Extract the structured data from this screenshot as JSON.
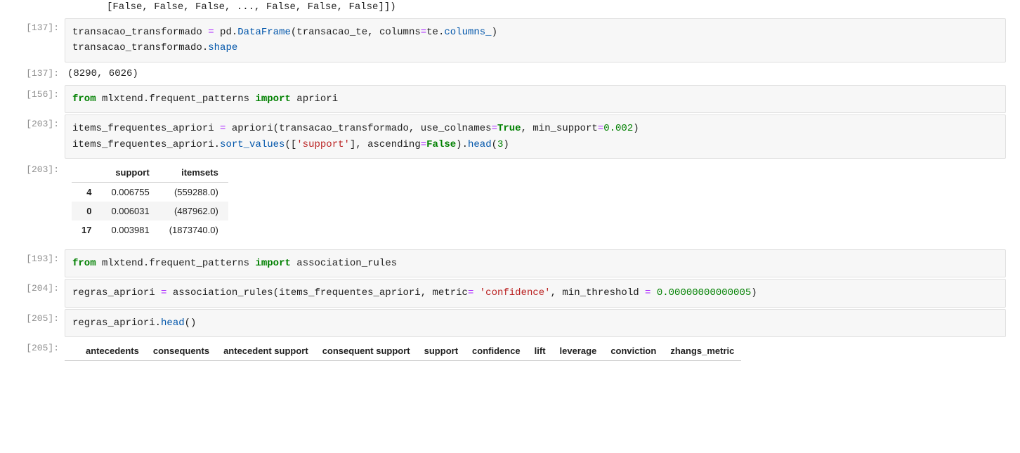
{
  "top_output": "[False, False, False, ..., False, False, False]])",
  "cells": {
    "c137a": {
      "prompt": "[137]:",
      "code": [
        {
          "type": "line",
          "tokens": [
            {
              "t": "name",
              "v": "transacao_transformado "
            },
            {
              "t": "op",
              "v": "="
            },
            {
              "t": "name",
              "v": " pd"
            },
            {
              "t": "punct",
              "v": "."
            },
            {
              "t": "call",
              "v": "DataFrame"
            },
            {
              "t": "punct",
              "v": "("
            },
            {
              "t": "name",
              "v": "transacao_te"
            },
            {
              "t": "punct",
              "v": ", "
            },
            {
              "t": "name",
              "v": "columns"
            },
            {
              "t": "op",
              "v": "="
            },
            {
              "t": "name",
              "v": "te"
            },
            {
              "t": "punct",
              "v": "."
            },
            {
              "t": "call",
              "v": "columns_"
            },
            {
              "t": "punct",
              "v": ")"
            }
          ]
        },
        {
          "type": "line",
          "tokens": [
            {
              "t": "name",
              "v": "transacao_transformado"
            },
            {
              "t": "punct",
              "v": "."
            },
            {
              "t": "call",
              "v": "shape"
            }
          ]
        }
      ]
    },
    "c137b": {
      "prompt": "[137]:",
      "plain": "(8290, 6026)"
    },
    "c156": {
      "prompt": "[156]:",
      "code": [
        {
          "type": "line",
          "tokens": [
            {
              "t": "kw",
              "v": "from"
            },
            {
              "t": "name",
              "v": " mlxtend"
            },
            {
              "t": "punct",
              "v": "."
            },
            {
              "t": "name",
              "v": "frequent_patterns "
            },
            {
              "t": "kw",
              "v": "import"
            },
            {
              "t": "name",
              "v": " apriori"
            }
          ]
        }
      ]
    },
    "c203a": {
      "prompt": "[203]:",
      "code": [
        {
          "type": "line",
          "tokens": [
            {
              "t": "name",
              "v": "items_frequentes_apriori "
            },
            {
              "t": "op",
              "v": "="
            },
            {
              "t": "name",
              "v": " apriori"
            },
            {
              "t": "punct",
              "v": "("
            },
            {
              "t": "name",
              "v": "transacao_transformado"
            },
            {
              "t": "punct",
              "v": ", "
            },
            {
              "t": "name",
              "v": "use_colnames"
            },
            {
              "t": "op",
              "v": "="
            },
            {
              "t": "bool",
              "v": "True"
            },
            {
              "t": "punct",
              "v": ", "
            },
            {
              "t": "name",
              "v": "min_support"
            },
            {
              "t": "op",
              "v": "="
            },
            {
              "t": "num",
              "v": "0.002"
            },
            {
              "t": "punct",
              "v": ")"
            }
          ]
        },
        {
          "type": "line",
          "tokens": [
            {
              "t": "name",
              "v": "items_frequentes_apriori"
            },
            {
              "t": "punct",
              "v": "."
            },
            {
              "t": "call",
              "v": "sort_values"
            },
            {
              "t": "punct",
              "v": "(["
            },
            {
              "t": "str",
              "v": "'support'"
            },
            {
              "t": "punct",
              "v": "], "
            },
            {
              "t": "name",
              "v": "ascending"
            },
            {
              "t": "op",
              "v": "="
            },
            {
              "t": "bool",
              "v": "False"
            },
            {
              "t": "punct",
              "v": ")"
            },
            {
              "t": "punct",
              "v": "."
            },
            {
              "t": "call",
              "v": "head"
            },
            {
              "t": "punct",
              "v": "("
            },
            {
              "t": "num",
              "v": "3"
            },
            {
              "t": "punct",
              "v": ")"
            }
          ]
        }
      ]
    },
    "c203b": {
      "prompt": "[203]:",
      "df": {
        "columns": [
          "support",
          "itemsets"
        ],
        "rows": [
          {
            "idx": "4",
            "support": "0.006755",
            "itemsets": "(559288.0)"
          },
          {
            "idx": "0",
            "support": "0.006031",
            "itemsets": "(487962.0)"
          },
          {
            "idx": "17",
            "support": "0.003981",
            "itemsets": "(1873740.0)"
          }
        ]
      }
    },
    "c193": {
      "prompt": "[193]:",
      "code": [
        {
          "type": "line",
          "tokens": [
            {
              "t": "kw",
              "v": "from"
            },
            {
              "t": "name",
              "v": " mlxtend"
            },
            {
              "t": "punct",
              "v": "."
            },
            {
              "t": "name",
              "v": "frequent_patterns "
            },
            {
              "t": "kw",
              "v": "import"
            },
            {
              "t": "name",
              "v": " association_rules"
            }
          ]
        }
      ]
    },
    "c204": {
      "prompt": "[204]:",
      "code": [
        {
          "type": "line",
          "tokens": [
            {
              "t": "name",
              "v": "regras_apriori "
            },
            {
              "t": "op",
              "v": "="
            },
            {
              "t": "name",
              "v": " association_rules"
            },
            {
              "t": "punct",
              "v": "("
            },
            {
              "t": "name",
              "v": "items_frequentes_apriori"
            },
            {
              "t": "punct",
              "v": ", "
            },
            {
              "t": "name",
              "v": "metric"
            },
            {
              "t": "op",
              "v": "="
            },
            {
              "t": "name",
              "v": " "
            },
            {
              "t": "str",
              "v": "'confidence'"
            },
            {
              "t": "punct",
              "v": ", "
            },
            {
              "t": "name",
              "v": "min_threshold "
            },
            {
              "t": "op",
              "v": "="
            },
            {
              "t": "name",
              "v": " "
            },
            {
              "t": "num",
              "v": "0.00000000000005"
            },
            {
              "t": "punct",
              "v": ")"
            }
          ]
        }
      ]
    },
    "c205a": {
      "prompt": "[205]:",
      "code": [
        {
          "type": "line",
          "tokens": [
            {
              "t": "name",
              "v": "regras_apriori"
            },
            {
              "t": "punct",
              "v": "."
            },
            {
              "t": "call",
              "v": "head"
            },
            {
              "t": "punct",
              "v": "()"
            }
          ]
        }
      ]
    },
    "c205b": {
      "prompt": "[205]:",
      "df_header": [
        "antecedents",
        "consequents",
        "antecedent support",
        "consequent support",
        "support",
        "confidence",
        "lift",
        "leverage",
        "conviction",
        "zhangs_metric"
      ]
    }
  }
}
